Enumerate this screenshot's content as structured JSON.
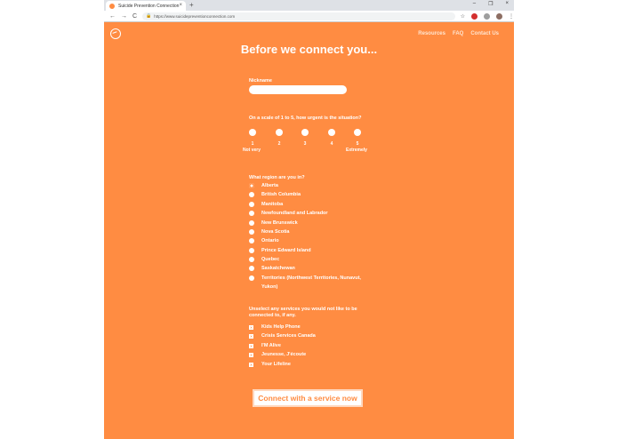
{
  "browser": {
    "tab_title": "Suicide Prevention Connection",
    "tab_close": "×",
    "new_tab": "+",
    "window_controls": [
      "–",
      "❐",
      "×"
    ],
    "url": "https://www.suicidepreventionconnection.com",
    "nav_back": "←",
    "nav_forward": "→",
    "nav_reload": "C",
    "ext_star": "☆",
    "ext_menu": "⋮"
  },
  "page": {
    "nav": [
      "Resources",
      "FAQ",
      "Contact Us"
    ],
    "heading": "Before we connect you...",
    "nickname_label": "Nickname",
    "nickname_value": "",
    "urgency_label": "On a scale of 1 to 5, how urgent is the situation?",
    "scale": [
      "1",
      "2",
      "3",
      "4",
      "5"
    ],
    "scale_low": "Not very",
    "scale_high": "Extremely",
    "region_label": "What region are you in?",
    "regions": [
      "Alberta",
      "British Columbia",
      "Manitoba",
      "Newfoundland and Labrador",
      "New Brunswick",
      "Nova Scotia",
      "Ontario",
      "Prince Edward Island",
      "Quebec",
      "Saskatchewan",
      "Territories (Northwest Territories, Nunavut,",
      "Yukon)"
    ],
    "services_label_1": "Unselect any services you would not like to be",
    "services_label_2": "connected to, if any.",
    "services": [
      "Kids Help Phone",
      "Crisis Services Canada",
      "I'M Alive",
      "Jeunesse, J'écoute",
      "Your Lifeline"
    ],
    "checkbox_mark": "✕",
    "cta": "Connect with a service now"
  },
  "colors": {
    "brand": "#ff8c42",
    "text": "#ffffff"
  }
}
